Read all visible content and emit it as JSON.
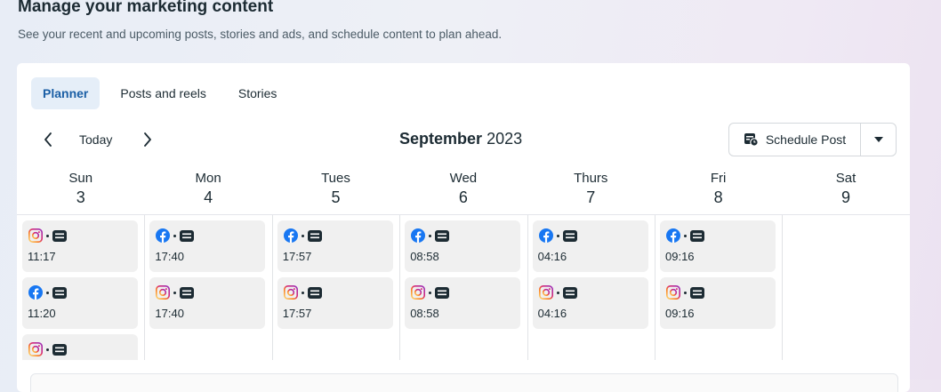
{
  "header": {
    "title": "Manage your marketing content",
    "subtitle": "See your recent and upcoming posts, stories and ads, and schedule content to plan ahead."
  },
  "tabs": [
    {
      "label": "Planner",
      "active": true
    },
    {
      "label": "Posts and reels",
      "active": false
    },
    {
      "label": "Stories",
      "active": false
    }
  ],
  "nav": {
    "today_label": "Today",
    "month": "September",
    "year": "2023"
  },
  "schedule": {
    "label": "Schedule Post"
  },
  "colors": {
    "facebook": "#1877f2",
    "instagram_gradient": [
      "#feda75",
      "#d62976",
      "#962fbf"
    ],
    "accent": "#1b5fa5"
  },
  "days": [
    {
      "name": "Sun",
      "date": "3",
      "posts": [
        {
          "platform": "instagram",
          "type": "post",
          "time": "11:17"
        },
        {
          "platform": "facebook",
          "type": "post",
          "time": "11:20"
        },
        {
          "platform": "instagram",
          "type": "post",
          "time": ""
        }
      ]
    },
    {
      "name": "Mon",
      "date": "4",
      "posts": [
        {
          "platform": "facebook",
          "type": "post",
          "time": "17:40"
        },
        {
          "platform": "instagram",
          "type": "post",
          "time": "17:40"
        }
      ]
    },
    {
      "name": "Tues",
      "date": "5",
      "posts": [
        {
          "platform": "facebook",
          "type": "post",
          "time": "17:57"
        },
        {
          "platform": "instagram",
          "type": "post",
          "time": "17:57"
        }
      ]
    },
    {
      "name": "Wed",
      "date": "6",
      "posts": [
        {
          "platform": "facebook",
          "type": "post",
          "time": "08:58"
        },
        {
          "platform": "instagram",
          "type": "post",
          "time": "08:58"
        }
      ]
    },
    {
      "name": "Thurs",
      "date": "7",
      "posts": [
        {
          "platform": "facebook",
          "type": "post",
          "time": "04:16"
        },
        {
          "platform": "instagram",
          "type": "post",
          "time": "04:16"
        }
      ]
    },
    {
      "name": "Fri",
      "date": "8",
      "posts": [
        {
          "platform": "facebook",
          "type": "post",
          "time": "09:16"
        },
        {
          "platform": "instagram",
          "type": "post",
          "time": "09:16"
        }
      ]
    },
    {
      "name": "Sat",
      "date": "9",
      "posts": []
    }
  ]
}
